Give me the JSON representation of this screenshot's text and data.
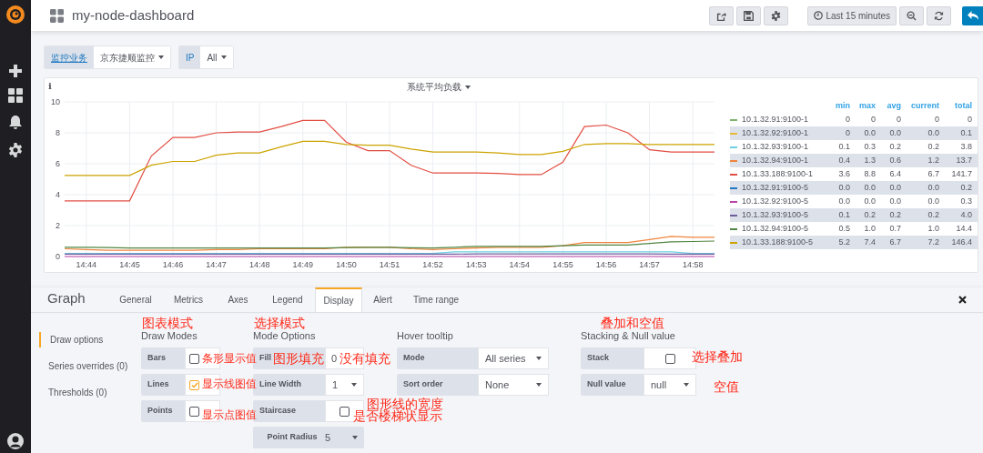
{
  "top_bar": {
    "title": "my-node-dashboard",
    "time_range": "Last 15 minutes"
  },
  "variables": [
    {
      "label": "监控业务",
      "value": "京东捷顺监控"
    },
    {
      "label": "IP",
      "value": "All"
    }
  ],
  "panel": {
    "info": "i",
    "title": "系统平均负载",
    "chart_data": {
      "type": "line",
      "categories": [
        null,
        "14:44",
        null,
        "14:45",
        null,
        "14:46",
        null,
        "14:47",
        null,
        "14:48",
        null,
        "14:49",
        null,
        "14:50",
        null,
        "14:51",
        null,
        "14:52",
        null,
        "14:53",
        null,
        "14:54",
        null,
        "14:55",
        null,
        "14:56",
        null,
        "14:57",
        null,
        "14:58",
        null
      ],
      "ylim": [
        0,
        10
      ],
      "yticks": [
        0,
        2,
        4,
        6,
        8,
        10
      ],
      "grid": true,
      "series": [
        {
          "name": "10.1.32.91:9100-1",
          "color": "#7eb26d",
          "values": [
            null,
            null,
            null,
            null,
            null,
            null,
            null,
            null,
            null,
            null,
            null,
            null,
            null,
            null,
            null,
            null,
            null,
            null,
            null,
            null,
            null,
            null,
            null,
            null,
            null,
            null,
            null,
            null,
            null,
            null,
            null
          ]
        },
        {
          "name": "10.1.32.92:9100-1",
          "color": "#eab839",
          "values": [
            null,
            null,
            null,
            null,
            null,
            null,
            null,
            null,
            null,
            null,
            null,
            null,
            null,
            null,
            null,
            null,
            null,
            null,
            null,
            null,
            null,
            null,
            null,
            null,
            null,
            null,
            null,
            null,
            null,
            null,
            null
          ]
        },
        {
          "name": "10.1.32.93:9100-1",
          "color": "#6ed0e0",
          "values": [
            0.2,
            0.2,
            0.2,
            0.2,
            0.2,
            0.2,
            0.2,
            0.2,
            0.2,
            0.2,
            0.2,
            0.2,
            0.2,
            0.2,
            0.2,
            0.2,
            0.2,
            0.2,
            0.3,
            0.3,
            0.3,
            0.3,
            0.3,
            0.3,
            0.3,
            0.3,
            0.3,
            0.3,
            0.3,
            0.2,
            0.2
          ]
        },
        {
          "name": "10.1.32.94:9100-1",
          "color": "#ef843c",
          "values": [
            0.5,
            0.45,
            0.4,
            0.4,
            0.4,
            0.4,
            0.4,
            0.45,
            0.45,
            0.5,
            0.5,
            0.52,
            0.5,
            0.6,
            0.6,
            0.6,
            0.5,
            0.45,
            0.5,
            0.55,
            0.6,
            0.6,
            0.6,
            0.7,
            0.9,
            0.9,
            0.9,
            1.1,
            1.3,
            1.25,
            1.25
          ]
        },
        {
          "name": "10.1.33.188:9100-1",
          "color": "#e24d42",
          "values": [
            3.6,
            3.6,
            3.6,
            3.6,
            6.5,
            7.7,
            7.7,
            8.0,
            8.05,
            8.05,
            8.4,
            8.8,
            8.8,
            7.4,
            6.85,
            6.85,
            5.9,
            5.4,
            5.4,
            5.4,
            5.37,
            5.3,
            5.3,
            6.1,
            8.4,
            8.5,
            8.0,
            6.9,
            6.75,
            6.75,
            6.75
          ]
        },
        {
          "name": "10.1.32.91:9100-5",
          "color": "#1f78c1",
          "values": [
            null,
            null,
            null,
            null,
            null,
            null,
            null,
            null,
            null,
            null,
            null,
            null,
            null,
            null,
            null,
            null,
            null,
            null,
            null,
            null,
            null,
            null,
            null,
            null,
            null,
            null,
            null,
            null,
            null,
            null,
            null
          ]
        },
        {
          "name": "10.1.32.92:9100-5",
          "color": "#ba43a9",
          "values": [
            0,
            0,
            0,
            0,
            0,
            0,
            0,
            0,
            0,
            0,
            0,
            0,
            0,
            0,
            0,
            0,
            0,
            0,
            0,
            0,
            0,
            0,
            0,
            0,
            0,
            0,
            0,
            0,
            0,
            0,
            0
          ]
        },
        {
          "name": "10.1.32.93:9100-5",
          "color": "#705da0",
          "values": [
            0.15,
            0.15,
            0.15,
            0.15,
            0.15,
            0.15,
            0.15,
            0.15,
            0.15,
            0.15,
            0.15,
            0.15,
            0.15,
            0.15,
            0.15,
            0.15,
            0.15,
            0.15,
            0.15,
            0.17,
            0.17,
            0.17,
            0.17,
            0.17,
            0.17,
            0.17,
            0.17,
            0.17,
            0.15,
            0.15,
            0.15
          ]
        },
        {
          "name": "10.1.32.94:9100-5",
          "color": "#508642",
          "values": [
            0.6,
            0.6,
            0.58,
            0.55,
            0.55,
            0.55,
            0.55,
            0.55,
            0.55,
            0.55,
            0.55,
            0.55,
            0.55,
            0.58,
            0.6,
            0.6,
            0.57,
            0.55,
            0.6,
            0.65,
            0.65,
            0.65,
            0.65,
            0.7,
            0.75,
            0.75,
            0.75,
            0.85,
            0.95,
            0.97,
            1.0
          ]
        },
        {
          "name": "10.1.33.188:9100-5",
          "color": "#cca300",
          "values": [
            5.25,
            5.25,
            5.25,
            5.25,
            5.9,
            6.15,
            6.15,
            6.55,
            6.7,
            6.7,
            7.1,
            7.45,
            7.45,
            7.25,
            7.2,
            7.2,
            6.95,
            6.75,
            6.75,
            6.75,
            6.7,
            6.6,
            6.6,
            6.8,
            7.25,
            7.3,
            7.3,
            7.25,
            7.25,
            7.25,
            7.25
          ]
        }
      ]
    },
    "legend": {
      "columns": [
        "min",
        "max",
        "avg",
        "current",
        "total"
      ],
      "rows": [
        {
          "values": [
            "0",
            "0",
            "0",
            "0",
            "0"
          ]
        },
        {
          "values": [
            "0",
            "0.0",
            "0.0",
            "0.0",
            "0.1"
          ]
        },
        {
          "values": [
            "0.1",
            "0.3",
            "0.2",
            "0.2",
            "3.8"
          ]
        },
        {
          "values": [
            "0.4",
            "1.3",
            "0.6",
            "1.2",
            "13.7"
          ]
        },
        {
          "values": [
            "3.6",
            "8.8",
            "6.4",
            "6.7",
            "141.7"
          ]
        },
        {
          "values": [
            "0.0",
            "0.0",
            "0.0",
            "0.0",
            "0.2"
          ]
        },
        {
          "values": [
            "0.0",
            "0.0",
            "0.0",
            "0.0",
            "0.3"
          ]
        },
        {
          "values": [
            "0.1",
            "0.2",
            "0.2",
            "0.2",
            "4.0"
          ]
        },
        {
          "values": [
            "0.5",
            "1.0",
            "0.7",
            "1.0",
            "14.4"
          ]
        },
        {
          "values": [
            "5.2",
            "7.4",
            "6.7",
            "7.2",
            "146.4"
          ]
        }
      ]
    }
  },
  "editor": {
    "title": "Graph",
    "tabs": [
      {
        "label": "General",
        "selected": false
      },
      {
        "label": "Metrics",
        "selected": false
      },
      {
        "label": "Axes",
        "selected": false
      },
      {
        "label": "Legend",
        "selected": false
      },
      {
        "label": "Display",
        "selected": true
      },
      {
        "label": "Alert",
        "selected": false
      },
      {
        "label": "Time range",
        "selected": false
      }
    ],
    "side_options": [
      {
        "label": "Draw options",
        "selected": true
      },
      {
        "label": "Series overrides (0)",
        "selected": false
      },
      {
        "label": "Thresholds (0)",
        "selected": false
      }
    ],
    "sections": [
      {
        "title": "Draw Modes",
        "rows": [
          {
            "kind": "checkbox",
            "label": "Bars",
            "checked": false
          },
          {
            "kind": "checkbox",
            "label": "Lines",
            "checked": true
          },
          {
            "kind": "checkbox",
            "label": "Points",
            "checked": false
          }
        ]
      },
      {
        "title": "Mode Options",
        "rows": [
          {
            "kind": "value",
            "label": "Fill",
            "value": "0"
          },
          {
            "kind": "select",
            "label": "Line Width",
            "value": "1"
          },
          {
            "kind": "checkbox",
            "label": "Staircase",
            "checked": false
          },
          {
            "kind": "inline",
            "label": "Point Radius",
            "value": "5"
          }
        ]
      },
      {
        "title": "Hover tooltip",
        "rows": [
          {
            "kind": "select",
            "label": "Mode",
            "value": "All series"
          },
          {
            "kind": "select",
            "label": "Sort order",
            "value": "None"
          }
        ]
      },
      {
        "title": "Stacking & Null value",
        "rows": [
          {
            "kind": "checkbox",
            "label": "Stack",
            "checked": false
          },
          {
            "kind": "select",
            "label": "Null value",
            "value": "null"
          }
        ]
      }
    ]
  },
  "annotations": [
    {
      "text": "图表模式"
    },
    {
      "text": "选择模式"
    },
    {
      "text": "叠加和空值"
    },
    {
      "text": "条形显示值"
    },
    {
      "text": "显示线图值"
    },
    {
      "text": "显示点图值"
    },
    {
      "text": "图形填充"
    },
    {
      "text": "没有填充"
    },
    {
      "text": "图形线的宽度"
    },
    {
      "text": "是否楼梯状显示"
    },
    {
      "text": "选择叠加"
    },
    {
      "text": "空值"
    }
  ]
}
